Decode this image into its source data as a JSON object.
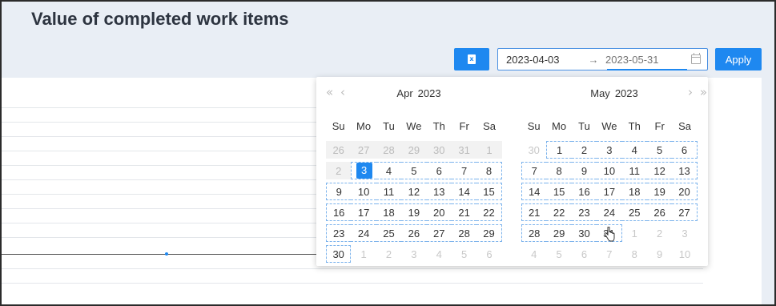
{
  "header": {
    "title": "Value of completed work items"
  },
  "toolbar": {
    "export_icon": "excel-icon",
    "export_glyph": "x",
    "range_start": "2023-04-03",
    "range_separator": "→",
    "range_end_placeholder": "2023-05-31",
    "apply_label": "Apply"
  },
  "calendar": {
    "left": {
      "month": "Apr",
      "year": "2023",
      "prev_year": "«",
      "prev_month": "‹",
      "weekdays": [
        "Su",
        "Mo",
        "Tu",
        "We",
        "Th",
        "Fr",
        "Sa"
      ],
      "weeks": [
        [
          "26",
          "27",
          "28",
          "29",
          "30",
          "31",
          "1"
        ],
        [
          "2",
          "3",
          "4",
          "5",
          "6",
          "7",
          "8"
        ],
        [
          "9",
          "10",
          "11",
          "12",
          "13",
          "14",
          "15"
        ],
        [
          "16",
          "17",
          "18",
          "19",
          "20",
          "21",
          "22"
        ],
        [
          "23",
          "24",
          "25",
          "26",
          "27",
          "28",
          "29"
        ],
        [
          "30",
          "1",
          "2",
          "3",
          "4",
          "5",
          "6"
        ]
      ],
      "selected_day": "3"
    },
    "right": {
      "month": "May",
      "year": "2023",
      "next_month": "›",
      "next_year": "»",
      "weekdays": [
        "Su",
        "Mo",
        "Tu",
        "We",
        "Th",
        "Fr",
        "Sa"
      ],
      "weeks": [
        [
          "30",
          "1",
          "2",
          "3",
          "4",
          "5",
          "6"
        ],
        [
          "7",
          "8",
          "9",
          "10",
          "11",
          "12",
          "13"
        ],
        [
          "14",
          "15",
          "16",
          "17",
          "18",
          "19",
          "20"
        ],
        [
          "21",
          "22",
          "23",
          "24",
          "25",
          "26",
          "27"
        ],
        [
          "28",
          "29",
          "30",
          "31",
          "1",
          "2",
          "3"
        ],
        [
          "4",
          "5",
          "6",
          "7",
          "8",
          "9",
          "10"
        ]
      ]
    }
  },
  "colors": {
    "accent": "#1e88f0",
    "range_border": "#7cb3ec"
  }
}
